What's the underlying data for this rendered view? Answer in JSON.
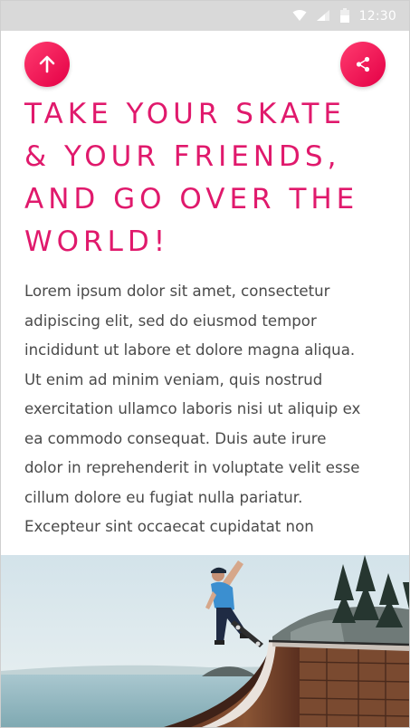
{
  "status_bar": {
    "time": "12:30",
    "icons": [
      "wifi-icon",
      "signal-icon",
      "battery-icon"
    ]
  },
  "actions": {
    "up_icon": "arrow-up-icon",
    "share_icon": "share-icon",
    "accent_color": "#e0196c"
  },
  "article": {
    "headline_lines": [
      "TAKE YOUR SKATE",
      "& YOUR FRIENDS,",
      "AND GO OVER THE",
      "WORLD!"
    ],
    "body_lines": [
      "Lorem ipsum dolor sit amet, consectetur",
      "adipiscing elit, sed do eiusmod tempor",
      "incididunt ut labore et dolore magna aliqua.",
      "Ut enim ad minim veniam, quis nostrud",
      "exercitation ullamco laboris nisi ut aliquip ex",
      "ea commodo consequat. Duis aute irure",
      "dolor in reprehenderit in voluptate velit esse",
      "cillum dolore eu fugiat nulla pariatur.",
      "Excepteur sint occaecat cupidatat non"
    ]
  }
}
